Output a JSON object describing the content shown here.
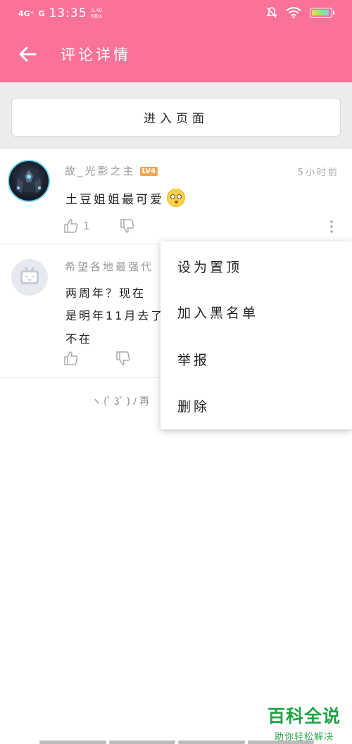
{
  "status_bar": {
    "network": "4G⁺",
    "network2": "G",
    "time": "13:35",
    "speed_value": "0.40",
    "speed_unit": "KB/s"
  },
  "header": {
    "title": "评论详情"
  },
  "enter_page_button": "进入页面",
  "comments": [
    {
      "username": "故_光影之主",
      "level": "LV4",
      "time": "5小时前",
      "text": "土豆姐姐最可爱",
      "like_count": "1"
    },
    {
      "username": "希望各地最强代",
      "lines": [
        "两周年？现在",
        "是明年11月去了",
        "不在"
      ]
    }
  ],
  "load_more": "ヽ(ﾟ3ﾟ)ﾉ再",
  "context_menu": {
    "items": [
      "设为置顶",
      "加入黑名单",
      "举报",
      "删除"
    ]
  },
  "watermark": {
    "title": "百科全说",
    "subtitle": "助你轻松解决"
  },
  "colors": {
    "brand_pink": "#fb7299",
    "level_badge": "#f3a54b",
    "watermark_green": "#1fa346"
  }
}
